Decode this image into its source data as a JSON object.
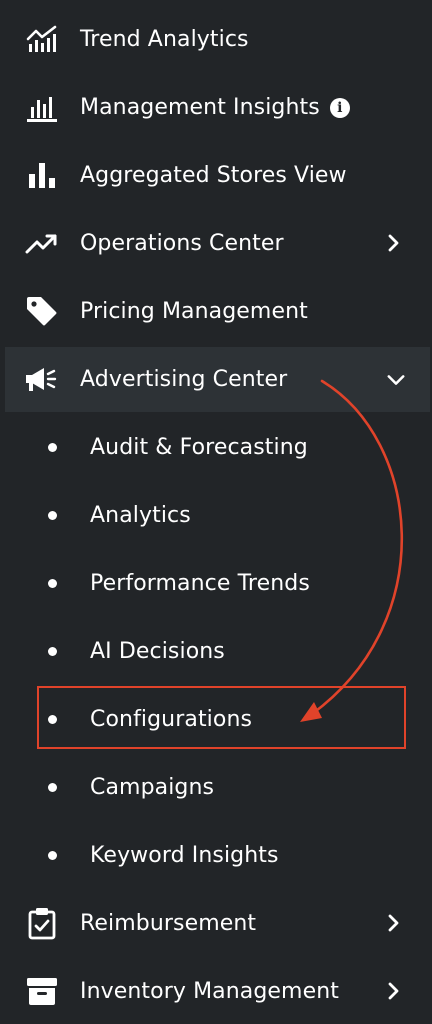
{
  "menu": {
    "items": [
      {
        "label": "Trend Analytics",
        "icon": "trend-chart-icon"
      },
      {
        "label": "Management Insights",
        "icon": "bar-chart-icon",
        "info_icon": "i"
      },
      {
        "label": "Aggregated Stores View",
        "icon": "stores-bar-icon"
      },
      {
        "label": "Operations Center",
        "icon": "trending-up-icon",
        "chevron": "right"
      },
      {
        "label": "Pricing Management",
        "icon": "tag-icon"
      },
      {
        "label": "Advertising Center",
        "icon": "megaphone-icon",
        "chevron": "down",
        "expanded": true
      },
      {
        "label": "Reimbursement",
        "icon": "clipboard-check-icon",
        "chevron": "right"
      },
      {
        "label": "Inventory Management",
        "icon": "archive-box-icon",
        "chevron": "right"
      }
    ],
    "advertising_submenu": [
      {
        "label": "Audit & Forecasting"
      },
      {
        "label": "Analytics"
      },
      {
        "label": "Performance Trends"
      },
      {
        "label": "AI Decisions"
      },
      {
        "label": "Configurations",
        "highlighted": true
      },
      {
        "label": "Campaigns"
      },
      {
        "label": "Keyword Insights"
      }
    ]
  },
  "annotation": {
    "color": "#e0432a",
    "target": "Configurations"
  },
  "colors": {
    "background": "#222528",
    "active_row": "#2d3236",
    "text": "#ffffff"
  }
}
